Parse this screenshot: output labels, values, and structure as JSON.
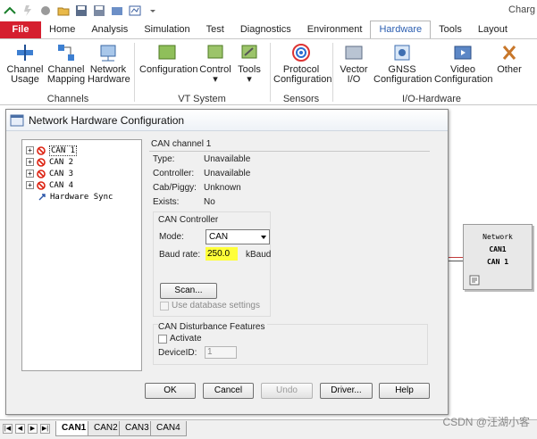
{
  "app": {
    "title_fragment": "Charg"
  },
  "ribbon_tabs": [
    "File",
    "Home",
    "Analysis",
    "Simulation",
    "Test",
    "Diagnostics",
    "Environment",
    "Hardware",
    "Tools",
    "Layout"
  ],
  "ribbon": {
    "channels": {
      "channel_usage": [
        "Channel",
        "Usage"
      ],
      "channel_mapping": [
        "Channel",
        "Mapping"
      ],
      "network_hardware": [
        "Network",
        "Hardware"
      ],
      "group": "Channels"
    },
    "vt_system": {
      "configuration": "Configuration",
      "control": "Control",
      "tools": "Tools",
      "group": "VT System"
    },
    "sensors": {
      "protocol_configuration": [
        "Protocol",
        "Configuration"
      ],
      "group": "Sensors"
    },
    "io_hardware": {
      "vector_io": [
        "Vector",
        "I/O"
      ],
      "gnss_configuration": [
        "GNSS",
        "Configuration"
      ],
      "video_configuration": [
        "Video",
        "Configuration"
      ],
      "other": "Other",
      "group": "I/O-Hardware"
    }
  },
  "dialog": {
    "title": "Network Hardware Configuration",
    "tree": [
      "CAN 1",
      "CAN 2",
      "CAN 3",
      "CAN 4",
      "Hardware Sync"
    ],
    "channel_heading": "CAN channel 1",
    "info": [
      {
        "label": "Type:",
        "value": "Unavailable"
      },
      {
        "label": "Controller:",
        "value": "Unavailable"
      },
      {
        "label": "Cab/Piggy:",
        "value": "Unknown"
      },
      {
        "label": "Exists:",
        "value": "No"
      }
    ],
    "can_controller": {
      "heading": "CAN Controller",
      "mode_label": "Mode:",
      "mode_value": "CAN",
      "baud_label": "Baud rate:",
      "baud_value": "250.0",
      "baud_unit": "kBaud",
      "scan_label": "Scan...",
      "use_db_label": "Use database settings"
    },
    "disturbance": {
      "heading": "CAN Disturbance Features",
      "activate_label": "Activate",
      "device_label": "DeviceID:",
      "device_value": "1"
    },
    "buttons": {
      "ok": "OK",
      "cancel": "Cancel",
      "undo": "Undo",
      "driver": "Driver...",
      "help": "Help"
    }
  },
  "network_node": {
    "title": "Network",
    "line1": "CAN1",
    "line2": "CAN 1"
  },
  "bottom_tabs": [
    "CAN1",
    "CAN2",
    "CAN3",
    "CAN4"
  ],
  "watermark": "CSDN @汪湖小客"
}
